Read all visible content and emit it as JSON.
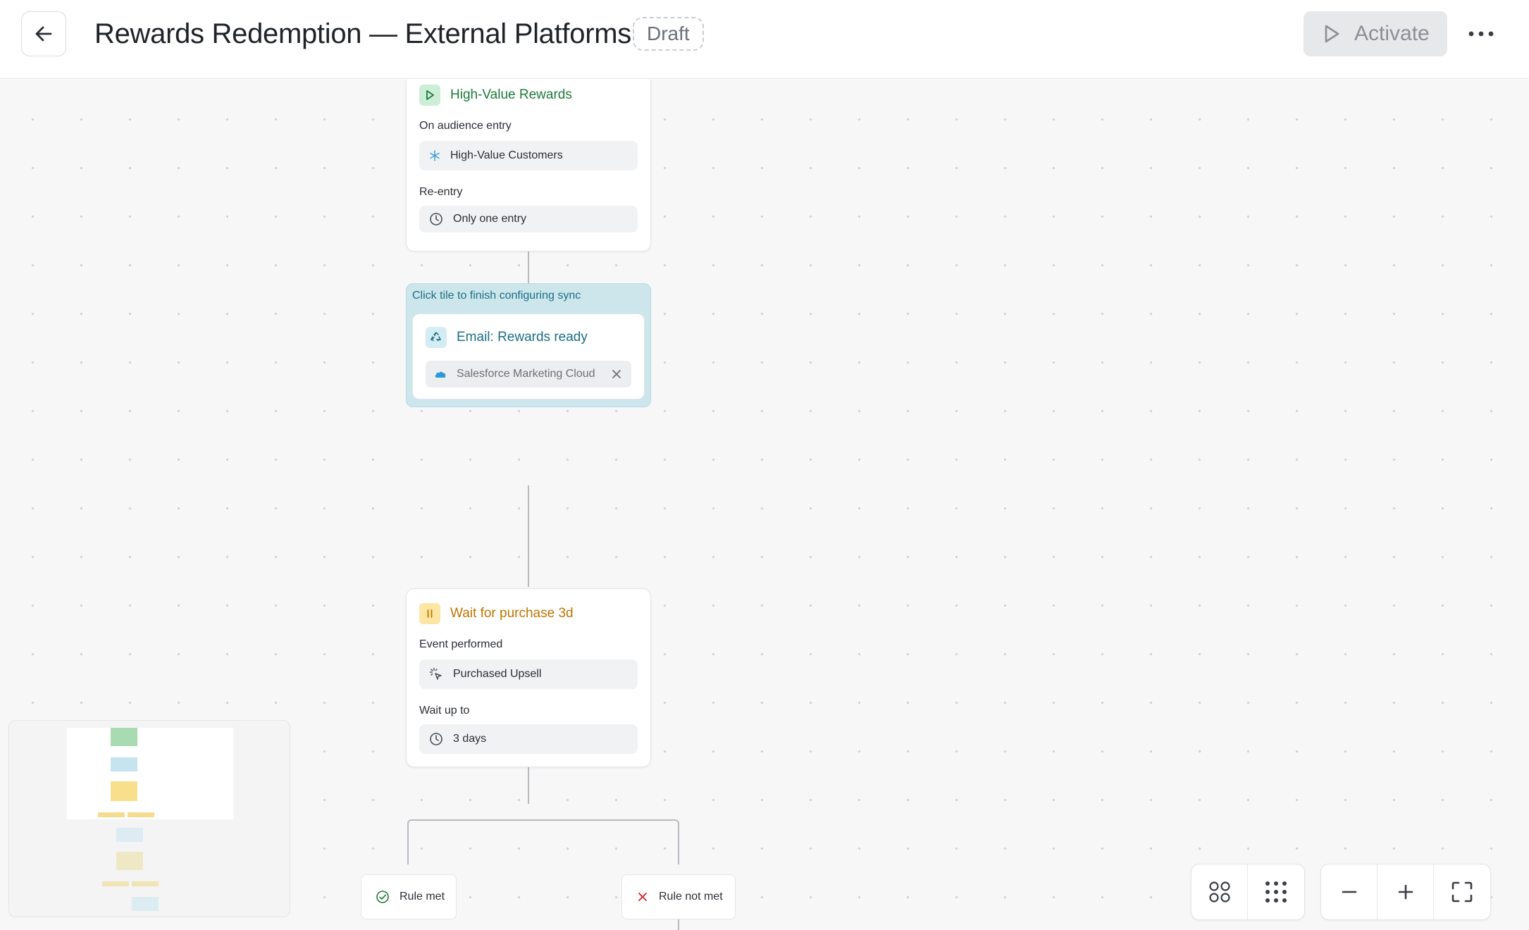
{
  "header": {
    "title": "Rewards Redemption — External Platforms",
    "status_badge": "Draft",
    "activate_label": "Activate"
  },
  "canvas": {
    "trigger_card": {
      "title": "High-Value Rewards",
      "entry_label": "On audience entry",
      "audience": "High-Value Customers",
      "reentry_label": "Re-entry",
      "reentry_value": "Only one entry",
      "accent": "#1e7a3a"
    },
    "sync_tile": {
      "hint": "Click tile to finish configuring sync",
      "title": "Email: Rewards ready",
      "destination": "Salesforce Marketing Cloud",
      "accent": "#1b6f86"
    },
    "wait_card": {
      "title": "Wait for purchase 3d",
      "event_label": "Event performed",
      "event_value": "Purchased Upsell",
      "wait_label": "Wait up to",
      "wait_value": "3 days",
      "accent": "#c07400"
    },
    "branches": {
      "met_label": "Rule met",
      "not_met_label": "Rule not met"
    }
  },
  "icons": {
    "back": "arrow-left-icon",
    "activate": "play-icon",
    "more": "more-dots-icon",
    "trigger": "play-icon",
    "audience": "snowflake-icon",
    "reentry": "clock-icon",
    "sync": "recycle-icon",
    "destination": "salesforce-cloud-icon",
    "wait": "pause-icon",
    "event": "cursor-click-icon",
    "duration": "clock-icon"
  }
}
